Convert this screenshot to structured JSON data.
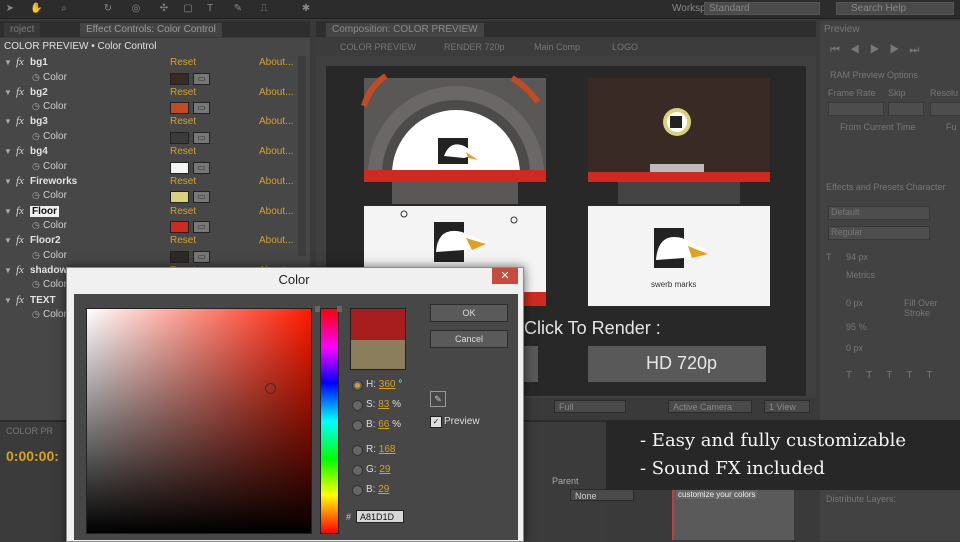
{
  "topbar": {
    "workspace_label": "Workspace:",
    "workspace_value": "Standard",
    "search_placeholder": "Search Help"
  },
  "effect_controls": {
    "tab_project": "roject",
    "tab_title": "Effect Controls: Color Control",
    "header": "COLOR PREVIEW • Color Control",
    "reset_label": "Reset",
    "about_label": "About...",
    "color_label": "Color",
    "effects": [
      {
        "name": "bg1",
        "color": "#3a2a26"
      },
      {
        "name": "bg2",
        "color": "#c44a24"
      },
      {
        "name": "bg3",
        "color": "#3b3b3b"
      },
      {
        "name": "bg4",
        "color": "#f4f4f4"
      },
      {
        "name": "Fireworks",
        "color": "#d8d27a"
      },
      {
        "name": "Floor",
        "color": "#d02a20"
      },
      {
        "name": "Floor2",
        "color": "#2e2a28"
      },
      {
        "name": "shadow",
        "color": "#555555"
      },
      {
        "name": "TEXT",
        "color": "#cccccc"
      }
    ]
  },
  "timeline": {
    "tab_label": "COLOR PR",
    "timecode": "0:00:00:",
    "parent_label": "Parent",
    "parent_value": "None",
    "clip_label": "customize your colors"
  },
  "composition": {
    "tab_title": "Composition: COLOR PREVIEW",
    "breadcrumbs": [
      "COLOR PREVIEW",
      "RENDER 720p",
      "Main Comp",
      "LOGO"
    ],
    "logo_text": "swerb marks",
    "render_prompt": "Click To Render :",
    "render_button": "HD 720p",
    "resolution": "Full",
    "camera": "Active Camera",
    "views": "1 View"
  },
  "right_panel": {
    "preview_tab": "Preview",
    "ram_options": "RAM Preview Options",
    "frame_rate": "Frame Rate",
    "skip": "Skip",
    "resolution": "Resolu",
    "from_current": "From Current Time",
    "full_screen": "Fu",
    "paragraph_tab": "Character",
    "align_tab": "Effects and Presets",
    "font": "Default",
    "style": "Regular",
    "size": "94 px",
    "metrics": "Metrics",
    "indent": "0 px",
    "fill": "Fill Over Stroke",
    "scale_v": "95 %",
    "scale_h": "0 px",
    "distribute": "Distribute Layers:"
  },
  "color_dialog": {
    "title": "Color",
    "close": "✕",
    "ok_label": "OK",
    "cancel_label": "Cancel",
    "h_label": "H:",
    "h_value": "360",
    "h_unit": "°",
    "s_label": "S:",
    "s_value": "83",
    "s_unit": "%",
    "b_label": "B:",
    "b_value": "66",
    "b_unit": "%",
    "r_label": "R:",
    "r_value": "168",
    "g_label": "G:",
    "g_value": "29",
    "bl_label": "B:",
    "bl_value": "29",
    "hex_label": "#",
    "hex_value": "A81D1D",
    "preview_label": "Preview",
    "new_color": "#a81d1d",
    "old_color": "#8b7e5c"
  },
  "caption": {
    "line1": "- Easy and fully customizable",
    "line2": "- Sound FX included"
  }
}
